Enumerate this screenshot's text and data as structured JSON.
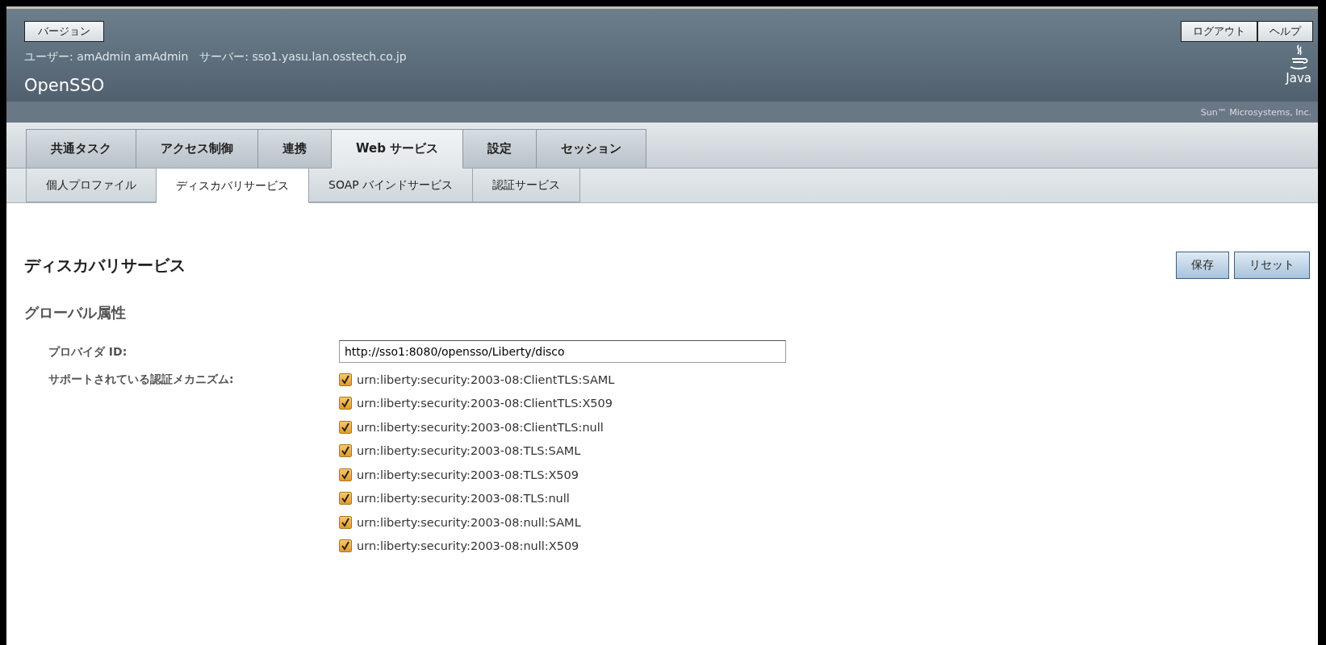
{
  "header": {
    "version_button": "バージョン",
    "user_info": "ユーザー: amAdmin amAdmin　サーバー: sso1.yasu.lan.osstech.co.jp",
    "product": "OpenSSO",
    "buttons": [
      "ログアウト",
      "ヘルプ"
    ],
    "logo_text": "Java",
    "vendor": "Sun™ Microsystems, Inc."
  },
  "tabs": [
    {
      "label": "共通タスク",
      "selected": false
    },
    {
      "label": "アクセス制御",
      "selected": false
    },
    {
      "label": "連携",
      "selected": false
    },
    {
      "label": "Web サービス",
      "selected": true
    },
    {
      "label": "設定",
      "selected": false
    },
    {
      "label": "セッション",
      "selected": false
    }
  ],
  "subtabs": [
    {
      "label": "個人プロファイル",
      "selected": false
    },
    {
      "label": "ディスカバリサービス",
      "selected": true
    },
    {
      "label": "SOAP バインドサービス",
      "selected": false
    },
    {
      "label": "認証サービス",
      "selected": false
    }
  ],
  "page": {
    "title": "ディスカバリサービス",
    "buttons": [
      "保存",
      "リセット"
    ],
    "section": "グローバル属性"
  },
  "form": {
    "provider_id": {
      "label": "プロバイダ ID:",
      "value": "http://sso1:8080/opensso/Liberty/disco"
    },
    "mechanisms": {
      "label": "サポートされている認証メカニズム:",
      "items": [
        {
          "label": "urn:liberty:security:2003-08:ClientTLS:SAML",
          "checked": true
        },
        {
          "label": "urn:liberty:security:2003-08:ClientTLS:X509",
          "checked": true
        },
        {
          "label": "urn:liberty:security:2003-08:ClientTLS:null",
          "checked": true
        },
        {
          "label": "urn:liberty:security:2003-08:TLS:SAML",
          "checked": true
        },
        {
          "label": "urn:liberty:security:2003-08:TLS:X509",
          "checked": true
        },
        {
          "label": "urn:liberty:security:2003-08:TLS:null",
          "checked": true
        },
        {
          "label": "urn:liberty:security:2003-08:null:SAML",
          "checked": true
        },
        {
          "label": "urn:liberty:security:2003-08:null:X509",
          "checked": true
        }
      ]
    }
  }
}
